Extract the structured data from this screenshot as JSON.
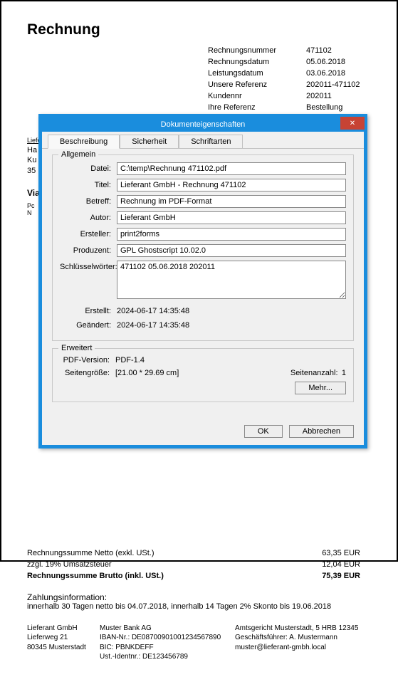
{
  "doc": {
    "title": "Rechnung",
    "info": {
      "labels": {
        "invoice_no": "Rechnungsnummer",
        "invoice_date": "Rechnungsdatum",
        "service_date": "Leistungsdatum",
        "our_ref": "Unsere Referenz",
        "customer_no": "Kundennr",
        "your_ref": "Ihre Referenz"
      },
      "values": {
        "invoice_no": "471102",
        "invoice_date": "05.06.2018",
        "service_date": "03.06.2018",
        "our_ref": "202011-471102",
        "customer_no": "202011",
        "your_ref": "Bestellung 123456"
      }
    },
    "sender_line": "Lieferant GmbH – Lieferweg 21 – 80345 Musterstadt",
    "partial_addr": {
      "l1": "Ha",
      "l2": "Ku",
      "l3": "35"
    },
    "via": "Via",
    "pos_hint": {
      "l1": "Pc",
      "l2": "N"
    },
    "summary": {
      "netto_label": "Rechnungssumme Netto (exkl. USt.)",
      "netto_value": "63,35 EUR",
      "vat_label": "zzgl. 19% Umsatzsteuer",
      "vat_value": "12,04 EUR",
      "brutto_label": "Rechnungssumme Brutto (inkl. USt.)",
      "brutto_value": "75,39 EUR"
    },
    "payment": {
      "title": "Zahlungsinformation:",
      "text": "innerhalb 30 Tagen netto bis 04.07.2018, innerhalb 14 Tagen 2% Skonto bis 19.06.2018"
    },
    "footer": {
      "col1": {
        "l1": "Lieferant GmbH",
        "l2": "Lieferweg 21",
        "l3": "80345 Musterstadt"
      },
      "col2": {
        "l1": "Muster Bank AG",
        "l2": "IBAN-Nr.: DE08700901001234567890",
        "l3": "BIC: PBNKDEFF",
        "l4": "Ust.-Identnr.: DE123456789"
      },
      "col3": {
        "l1": "Amtsgericht Musterstadt, 5 HRB 12345",
        "l2": "Geschäftsführer: A. Mustermann",
        "l3": "",
        "l4": "muster@lieferant-gmbh.local"
      }
    }
  },
  "dialog": {
    "title": "Dokumenteigenschaften",
    "tabs": {
      "t1": "Beschreibung",
      "t2": "Sicherheit",
      "t3": "Schriftarten"
    },
    "general": {
      "legend": "Allgemein",
      "labels": {
        "file": "Datei:",
        "title": "Titel:",
        "subject": "Betreff:",
        "author": "Autor:",
        "creator": "Ersteller:",
        "producer": "Produzent:",
        "keywords": "Schlüsselwörter:",
        "created": "Erstellt:",
        "modified": "Geändert:"
      },
      "values": {
        "file": "C:\\temp\\Rechnung 471102.pdf",
        "title": "Lieferant GmbH - Rechnung 471102",
        "subject": "Rechnung im PDF-Format",
        "author": "Lieferant GmbH",
        "creator": "print2forms",
        "producer": "GPL Ghostscript 10.02.0",
        "keywords": "471102 05.06.2018 202011",
        "created": "2024-06-17 14:35:48",
        "modified": "2024-06-17 14:35:48"
      }
    },
    "extended": {
      "legend": "Erweitert",
      "labels": {
        "pdf_version": "PDF-Version:",
        "page_size": "Seitengröße:",
        "page_count": "Seitenanzahl:"
      },
      "values": {
        "pdf_version": "PDF-1.4",
        "page_size": "[21.00 * 29.69 cm]",
        "page_count": "1"
      },
      "more_button": "Mehr..."
    },
    "buttons": {
      "ok": "OK",
      "cancel": "Abbrechen"
    }
  }
}
